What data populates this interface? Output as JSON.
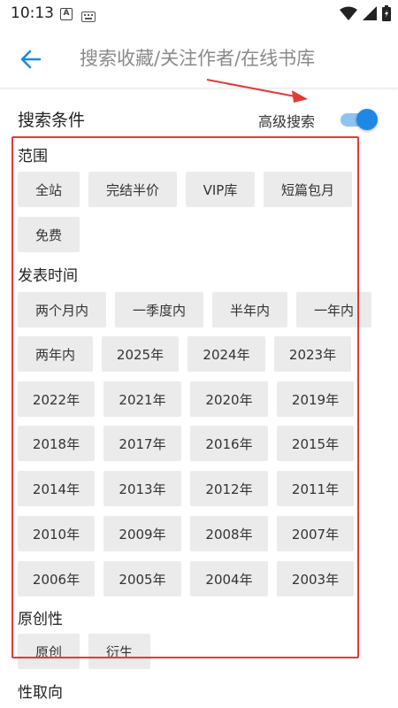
{
  "status_bar": {
    "time": "10:13",
    "notification_icon": "A",
    "keyboard_icon": "keyboard-icon",
    "right_icons": [
      "wifi-icon",
      "signal-icon",
      "battery-icon"
    ]
  },
  "app_bar": {
    "back_icon": "arrow-left-icon",
    "search_placeholder": "搜索收藏/关注作者/在线书库",
    "search_value": ""
  },
  "search_conditions": {
    "title": "搜索条件",
    "advanced_label": "高级搜索",
    "advanced_enabled": true
  },
  "sections": [
    {
      "label": "范围",
      "options": [
        "全站",
        "完结半价",
        "VIP库",
        "短篇包月",
        "免费"
      ]
    },
    {
      "label": "发表时间",
      "options": [
        "两个月内",
        "一季度内",
        "半年内",
        "一年内",
        "两年内",
        "2025年",
        "2024年",
        "2023年",
        "2022年",
        "2021年",
        "2020年",
        "2019年",
        "2018年",
        "2017年",
        "2016年",
        "2015年",
        "2014年",
        "2013年",
        "2012年",
        "2011年",
        "2010年",
        "2009年",
        "2008年",
        "2007年",
        "2006年",
        "2005年",
        "2004年",
        "2003年"
      ]
    },
    {
      "label": "原创性",
      "options": [
        "原创",
        "衍生"
      ]
    },
    {
      "label": "性取向",
      "options": []
    }
  ],
  "colors": {
    "accent": "#1e88e5",
    "chip_bg": "#ebebeb",
    "annotation": "#e53935"
  }
}
